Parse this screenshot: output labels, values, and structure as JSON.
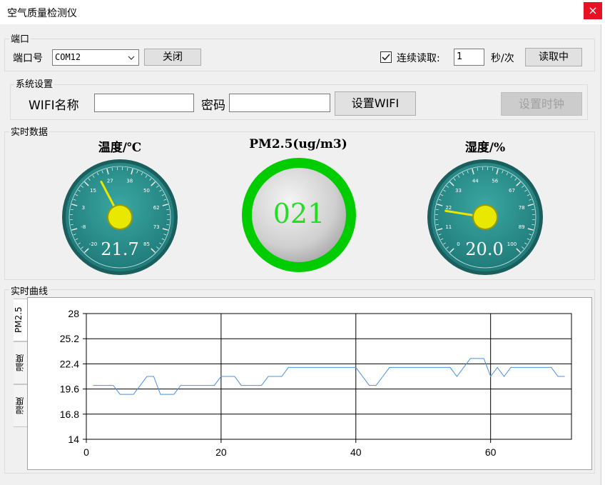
{
  "window": {
    "title": "空气质量检测仪",
    "close_glyph": "×"
  },
  "port": {
    "group_label": "端口",
    "port_label": "端口号",
    "port_value": "COM12",
    "close_label": "关闭",
    "continuous_checked": true,
    "continuous_label": "连续读取:",
    "interval_value": "1",
    "interval_unit": "秒/次",
    "read_label": "读取中"
  },
  "system": {
    "group_label": "系统设置",
    "wifi_name_label": "WIFI名称",
    "wifi_name_value": "",
    "password_label": "密码",
    "password_value": "",
    "set_wifi_label": "设置WIFI",
    "set_clock_label": "设置时钟"
  },
  "realtime": {
    "group_label": "实时数据",
    "temperature": {
      "title": "温度/℃",
      "value": "21.7",
      "value_num": 21.7,
      "min": -20,
      "max": 85,
      "ticks": [
        "-20",
        "-8",
        "3",
        "15",
        "27",
        "38",
        "50",
        "62",
        "73",
        "85"
      ]
    },
    "pm25": {
      "title": "PM2.5(ug/m3)",
      "value": "021",
      "ring_color": "#00cc00",
      "value_color": "#22dd22"
    },
    "humidity": {
      "title": "湿度/%",
      "value": "20.0",
      "value_num": 20.0,
      "min": 0,
      "max": 100,
      "ticks": [
        "0",
        "11",
        "22",
        "33",
        "44",
        "56",
        "67",
        "78",
        "89",
        "100"
      ]
    },
    "gauge_face_color": "#1f7a78",
    "needle_color": "#e8e800"
  },
  "curve": {
    "group_label": "实时曲线",
    "tabs": [
      "PM2.5",
      "温度",
      "湿度"
    ],
    "active_tab": 0
  },
  "chart_data": {
    "type": "line",
    "ylim": [
      14,
      28
    ],
    "xlim": [
      0,
      72
    ],
    "yticks": [
      "28",
      "25.2",
      "22.4",
      "19.6",
      "16.8",
      "14"
    ],
    "xticks": [
      "0",
      "20",
      "40",
      "60"
    ],
    "grid": true,
    "series": [
      {
        "color": "#4a90e2",
        "x": [
          1,
          4,
          5,
          7,
          8,
          9,
          10,
          11,
          12,
          13,
          14,
          19,
          20,
          21,
          22,
          23,
          24,
          25,
          26,
          27,
          28,
          29,
          30,
          31,
          32,
          33,
          34,
          35,
          36,
          37,
          38,
          39,
          40,
          41,
          42,
          43,
          44,
          45,
          46,
          47,
          48,
          49,
          50,
          51,
          52,
          53,
          54,
          55,
          56,
          57,
          58,
          59,
          60,
          61,
          62,
          63,
          64,
          65,
          66,
          67,
          68,
          69,
          70,
          71
        ],
        "y": [
          20,
          20,
          19,
          19,
          20,
          21,
          21,
          19,
          19,
          19,
          20,
          20,
          21,
          21,
          21,
          20,
          20,
          20,
          20,
          21,
          21,
          21,
          22,
          22,
          22,
          22,
          22,
          22,
          22,
          22,
          22,
          22,
          22,
          21,
          20,
          20,
          21,
          22,
          22,
          22,
          22,
          22,
          22,
          22,
          22,
          22,
          22,
          21,
          22,
          23,
          23,
          23,
          21,
          22,
          21,
          22,
          22,
          22,
          22,
          22,
          22,
          22,
          21,
          21
        ]
      }
    ]
  }
}
